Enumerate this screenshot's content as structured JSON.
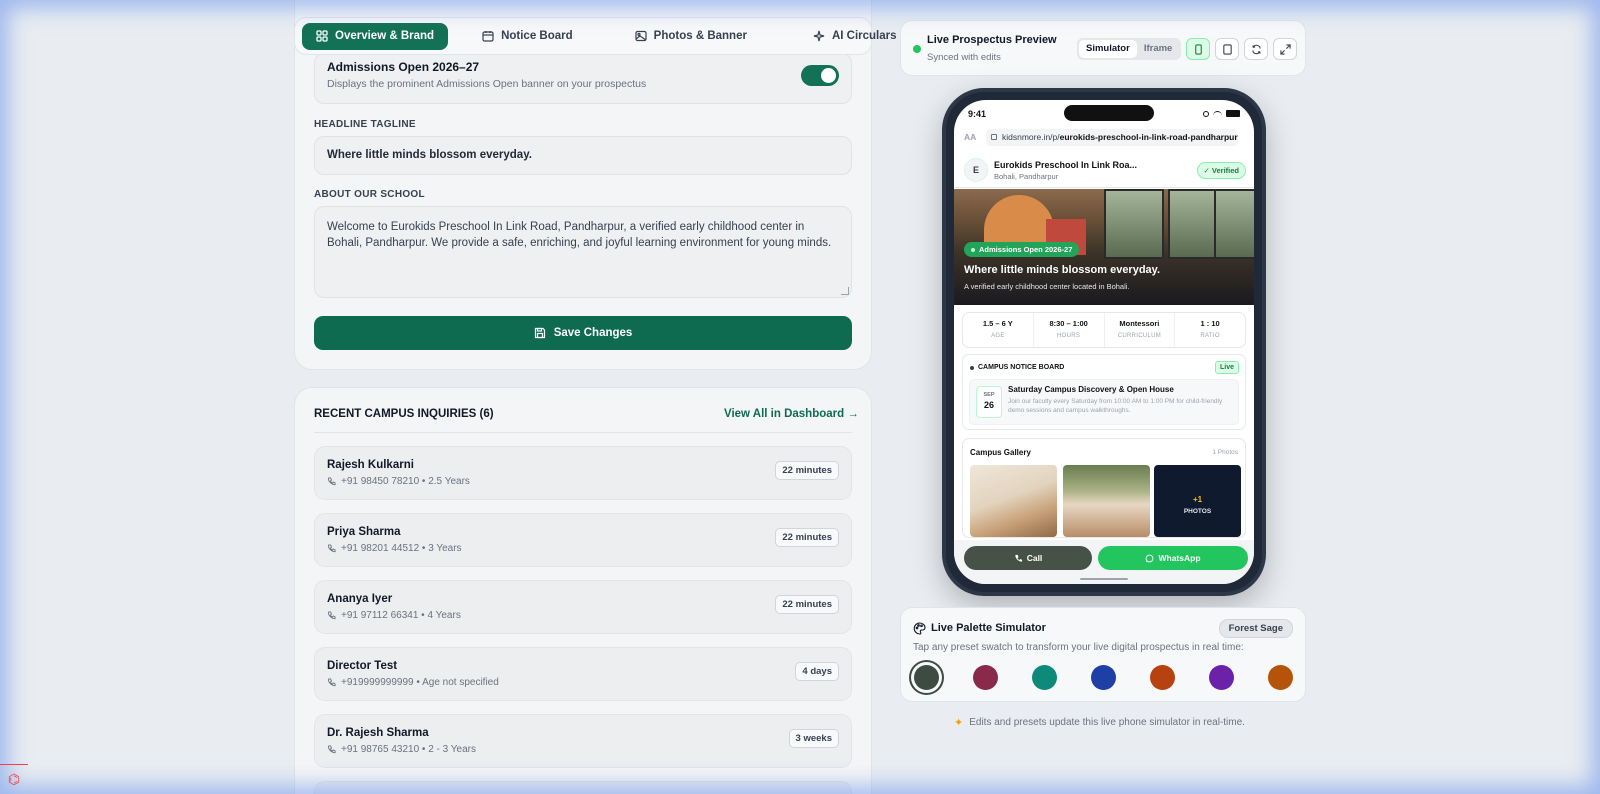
{
  "tabs": [
    {
      "label": "Overview & Brand",
      "icon": "grid-icon"
    },
    {
      "label": "Notice Board",
      "icon": "calendar-icon"
    },
    {
      "label": "Photos & Banner",
      "icon": "image-icon"
    },
    {
      "label": "AI Circulars",
      "icon": "sparkles-icon"
    }
  ],
  "admissions": {
    "title": "Admissions Open 2026–27",
    "desc": "Displays the prominent Admissions Open banner on your prospectus",
    "enabled": true
  },
  "headline": {
    "label": "HEADLINE TAGLINE",
    "value": "Where little minds blossom everyday."
  },
  "about": {
    "label": "ABOUT OUR SCHOOL",
    "value": "Welcome to Eurokids Preschool In Link Road, Pandharpur, a verified early childhood center in Bohali, Pandharpur. We provide a safe, enriching, and joyful learning environment for young minds."
  },
  "save_label": "Save Changes",
  "inquiries": {
    "title": "RECENT CAMPUS INQUIRIES (6)",
    "link": "View All in Dashboard →",
    "items": [
      {
        "name": "Rajesh Kulkarni",
        "meta": "+91 98450 78210 • 2.5 Years",
        "time": "22 minutes"
      },
      {
        "name": "Priya Sharma",
        "meta": "+91 98201 44512 • 3 Years",
        "time": "22 minutes"
      },
      {
        "name": "Ananya Iyer",
        "meta": "+91 97112 66341 • 4 Years",
        "time": "22 minutes"
      },
      {
        "name": "Director Test",
        "meta": "+919999999999 • Age not specified",
        "time": "4 days"
      },
      {
        "name": "Dr. Rajesh Sharma",
        "meta": "+91 98765 43210 • 2 - 3 Years",
        "time": "3 weeks"
      }
    ]
  },
  "preview": {
    "title": "Live Prospectus Preview",
    "subtitle": "Synced with edits",
    "mode_simulator": "Simulator",
    "mode_iframe": "Iframe"
  },
  "phone": {
    "time": "9:41",
    "aa": "AA",
    "url_prefix": "kidsnmore.in/p/",
    "url_path": "eurokids-preschool-in-link-road-pandharpur",
    "avatar": "E",
    "school_name": "Eurokids Preschool In Link Roa...",
    "school_loc": "Bohali, Pandharpur",
    "verified": "✓ Verified",
    "admission_pill": "Admissions Open 2026-27",
    "hero_title": "Where little minds blossom everyday.",
    "hero_sub": "A verified early childhood center located in Bohali.",
    "stats": [
      {
        "value": "1.5 – 6 Y",
        "label": "AGE"
      },
      {
        "value": "8:30 – 1:00",
        "label": "HOURS"
      },
      {
        "value": "Montessori",
        "label": "CURRICULUM"
      },
      {
        "value": "1 : 10",
        "label": "RATIO"
      }
    ],
    "notice_title": "CAMPUS NOTICE BOARD",
    "live": "Live",
    "event_month": "SEP",
    "event_day": "26",
    "event_title": "Saturday Campus Discovery & Open House",
    "event_desc": "Join our faculty every Saturday from 10:00 AM to 1:00 PM for child-friendly demo sessions and campus walkthroughs.",
    "gallery_title": "Campus Gallery",
    "gallery_count": "1 Photos",
    "more_plus": "+1",
    "more_label": "PHOTOS",
    "call": "Call",
    "whatsapp": "WhatsApp"
  },
  "palette": {
    "title": "Live Palette Simulator",
    "badge": "Forest Sage",
    "desc": "Tap any preset swatch to transform your live digital prospectus in real time:",
    "swatches": [
      "#3d4b42",
      "#8a2a4b",
      "#0e8a7a",
      "#1d3fa6",
      "#b8420f",
      "#6b21a8",
      "#b45309"
    ]
  },
  "footnote": "Edits and presets update this live phone simulator in real-time.",
  "colors": {
    "brand": "#0e6b50",
    "accent": "#22c55e"
  }
}
